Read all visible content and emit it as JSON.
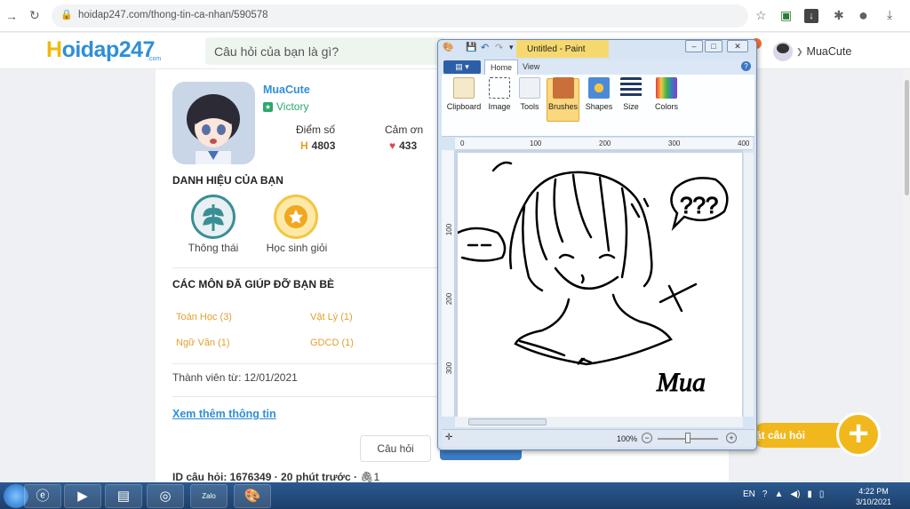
{
  "browser": {
    "url": "hoidap247.com/thong-tin-ca-nhan/590578"
  },
  "site": {
    "logo_h": "H",
    "logo_rest": "oidap247",
    "logo_com": ".com",
    "search_placeholder": "Câu hỏi của bạn là gì?",
    "header_user": "MuaCute"
  },
  "profile": {
    "username": "MuaCute",
    "rank": "Victory",
    "stats": [
      {
        "label": "Điểm số",
        "value": "4803"
      },
      {
        "label": "Cảm ơn",
        "value": "433"
      }
    ],
    "titles_heading": "DANH HIỆU CỦA BẠN",
    "badges": [
      {
        "label": "Thông thái",
        "color": "#3a8f96"
      },
      {
        "label": "Học sinh giỏi",
        "color": "#f5c542"
      }
    ],
    "subjects_heading": "CÁC MÔN ĐÃ GIÚP ĐỠ BẠN BÈ",
    "subjects": [
      "Toán Học (3)",
      "Vật Lý (1)",
      "Ngữ Văn (1)",
      "GDCD (1)"
    ],
    "member_since": "Thành viên từ: 12/01/2021",
    "more_link": "Xem thêm thông tin",
    "question_button": "Câu hỏi",
    "question_id": "ID câu hỏi: 1676349 · 20 phút trước · ",
    "question_attachments": "1",
    "ask_button": "ặt câu hỏi"
  },
  "paint": {
    "title": "Untitled - Paint",
    "tab_home": "Home",
    "tab_view": "View",
    "groups": [
      "Clipboard",
      "Image",
      "Tools",
      "Brushes",
      "Shapes",
      "Size",
      "Colors"
    ],
    "ruler_top": [
      "0",
      "100",
      "200",
      "300",
      "400"
    ],
    "ruler_left": [
      "100",
      "200",
      "300"
    ],
    "drawing_text": "Mua",
    "speech_text": "???",
    "zoom": "100%"
  },
  "taskbar": {
    "lang": "EN",
    "time": "4:22 PM",
    "date": "3/10/2021",
    "zalo": "Zalo"
  },
  "colors": {
    "brand_blue": "#2f8fd8",
    "brand_yellow": "#f1b81e",
    "rank_green": "#29a86a"
  }
}
